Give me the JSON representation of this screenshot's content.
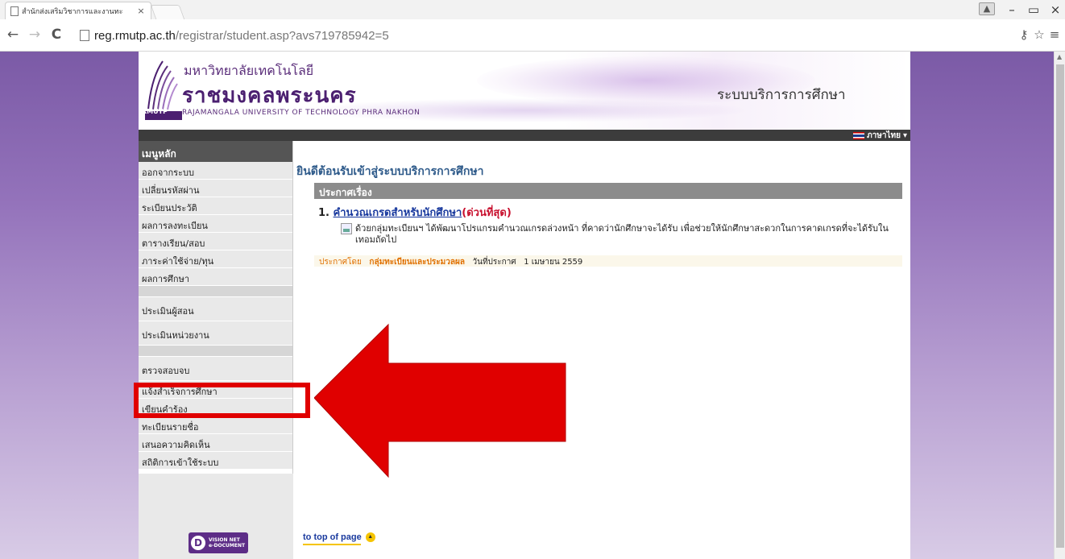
{
  "browser": {
    "tab_title": "สำนักส่งเสริมวิชาการและงานทะ",
    "tab_close": "×",
    "url_host": "reg.rmutp.ac.th",
    "url_path": "/registrar/student.asp?avs719785942=5",
    "window_controls": {
      "minimize": "–",
      "restore": "□",
      "close": "×"
    }
  },
  "banner": {
    "logo_th_line1": "มหาวิทยาลัยเทคโนโลยี",
    "logo_th_line2": "ราชมงคลพระนคร",
    "logo_en": "RAJAMANGALA UNIVERSITY OF TECHNOLOGY PHRA NAKHON",
    "logo_abbr": "RMUTP",
    "system_title": "ระบบบริการการศึกษา",
    "language": "ภาษาไทย"
  },
  "sidebar": {
    "heading": "เมนูหลัก",
    "items_group1": [
      "ออกจากระบบ",
      "เปลี่ยนรหัสผ่าน",
      "ระเบียนประวัติ",
      "ผลการลงทะเบียน",
      "ตารางเรียน/สอบ",
      "ภาระค่าใช้จ่าย/ทุน",
      "ผลการศึกษา"
    ],
    "items_group2": [
      "ประเมินผู้สอน",
      "ประเมินหน่วยงาน"
    ],
    "items_group3": [
      "ตรวจสอบจบ",
      "แจ้งสำเร็จการศึกษา",
      "เขียนคำร้อง",
      "ทะเบียนรายชื่อ",
      "เสนอความคิดเห็น",
      "สถิติการเข้าใช้ระบบ"
    ],
    "badge_title": "VISION NET",
    "badge_sub": "e-DOCUMENT"
  },
  "content": {
    "welcome": "ยินดีต้อนรับเข้าสู่ระบบบริการการศึกษา",
    "announcement_header": "ประกาศเรื่อง",
    "item_number": "1.",
    "item_title": "คำนวณเกรดสำหรับนักศึกษา",
    "item_urgent": "(ด่วนที่สุด)",
    "item_description": "ด้วยกลุ่มทะเบียนฯ ได้พัฒนาโปรแกรมคำนวณเกรดล่วงหน้า ที่คาดว่านักศึกษาจะได้รับ เพื่อช่วยให้นักศึกษาสะดวกในการคาดเกรดที่จะได้รับในเทอมถัดไป",
    "posted_by_label": "ประกาศโดย",
    "posted_by": "กลุ่มทะเบียนและประมวลผล",
    "date_label": "วันที่ประกาศ",
    "date": "1 เมษายน 2559",
    "top_link": "to top of page"
  },
  "colors": {
    "highlight": "#e00000",
    "arrow": "#e00000",
    "background_purple": "#7b5aa6"
  }
}
